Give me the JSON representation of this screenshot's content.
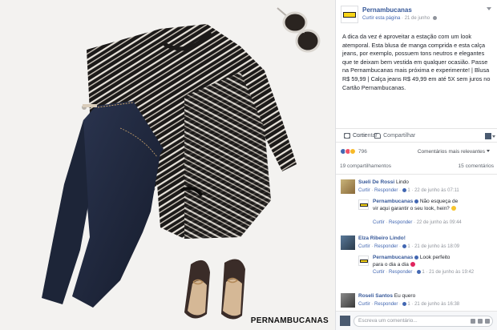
{
  "post": {
    "page_name": "Pernambucanas",
    "like_page": "Curtir esta página",
    "separator": "·",
    "date": "21 de junho",
    "text": "A dica da vez é aproveitar a estação com um look atemporal. Esta blusa de manga comprida e esta calça jeans, por exemplo, possuem tons neutros e elegantes que te deixam bem vestida em qualquer ocasião. Passe na Pernambucanas mais próxima e experimente! | Blusa R$ 59,99 | Calça jeans R$ 49,99 em até 5X sem juros no Cartão Pernambucanas."
  },
  "photo": {
    "brand_watermark": "PERNAMBUCANAS"
  },
  "actions": {
    "like": "Curtir",
    "comment": "Comentar",
    "share": "Compartilhar"
  },
  "reactions": {
    "count": "796",
    "sort": "Comentários mais relevantes"
  },
  "counts": {
    "shares": "19 compartilhamentos",
    "comments": "15 comentários"
  },
  "comments": [
    {
      "author": "Sueli De Rossi",
      "text": "Lindo",
      "like": "Curtir",
      "reply": "Responder",
      "likes": "1",
      "time": "22 de junho às 07:11",
      "reply_item": {
        "author": "Pernambucanas",
        "text": "Não esqueça de vir aqui garantir o seu look, hein?",
        "like": "Curtir",
        "reply": "Responder",
        "time": "22 de junho às 09:44"
      }
    },
    {
      "author": "Elza Ribeiro Lindo!",
      "text": "",
      "like": "Curtir",
      "reply": "Responder",
      "likes": "1",
      "time": "21 de junho às 18:09",
      "reply_item": {
        "author": "Pernambucanas",
        "text": "Look perfeito para o dia a dia",
        "like": "Curtir",
        "reply": "Responder",
        "likes": "1",
        "time": "21 de junho às 19:42"
      }
    },
    {
      "author": "Roseli Santos",
      "text": "Eu quero",
      "like": "Curtir",
      "reply": "Responder",
      "likes": "1",
      "time": "21 de junho às 16:38"
    }
  ],
  "composer": {
    "placeholder": "Escreva um comentário..."
  },
  "colors": {
    "link": "#365899",
    "brand_yellow": "#f7d417",
    "like_blue": "#4267b2"
  }
}
